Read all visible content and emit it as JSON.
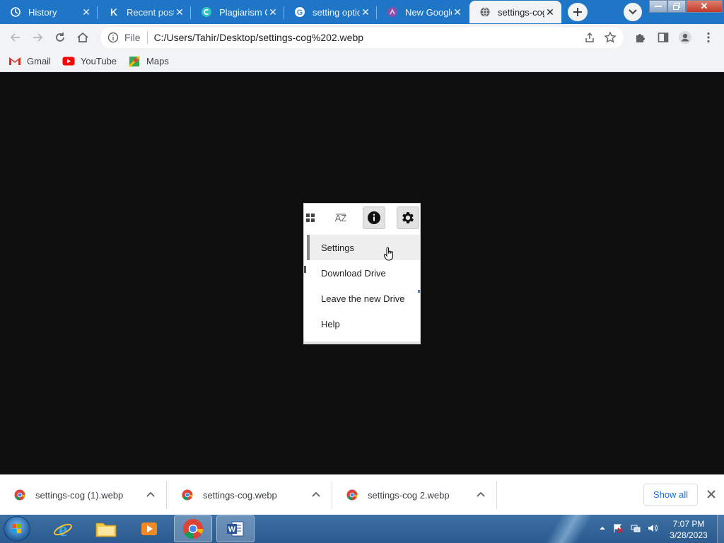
{
  "tabs": [
    {
      "title": "History",
      "icon": "history-icon"
    },
    {
      "title": "Recent posts",
      "icon": "k-logo-icon"
    },
    {
      "title": "Plagiarism Checker",
      "icon": "plagiarism-icon"
    },
    {
      "title": "setting options",
      "icon": "google-icon"
    },
    {
      "title": "New Google",
      "icon": "purple-logo-icon"
    },
    {
      "title": "settings-cog",
      "icon": "globe-icon"
    }
  ],
  "window_controls": {
    "close": "✕"
  },
  "toolbar": {
    "scheme": "File",
    "url": "C:/Users/Tahir/Desktop/settings-cog%202.webp"
  },
  "bookmarks": [
    {
      "label": "Gmail",
      "icon": "gmail-icon"
    },
    {
      "label": "YouTube",
      "icon": "youtube-icon"
    },
    {
      "label": "Maps",
      "icon": "maps-icon"
    }
  ],
  "image_content": {
    "menu_items": [
      "Settings",
      "Download Drive",
      "Leave the new Drive",
      "Help"
    ],
    "az_label": "AZ"
  },
  "downloads": {
    "items": [
      {
        "name": "settings-cog (1).webp"
      },
      {
        "name": "settings-cog.webp"
      },
      {
        "name": "settings-cog 2.webp"
      }
    ],
    "show_all": "Show all"
  },
  "taskbar": {
    "time": "7:07 PM",
    "date": "3/28/2023"
  },
  "colors": {
    "tabstrip": "#1f76c7",
    "toolbar": "#f1f3f4",
    "content_bg": "#0f0f0f",
    "link_blue": "#1a73e8"
  }
}
